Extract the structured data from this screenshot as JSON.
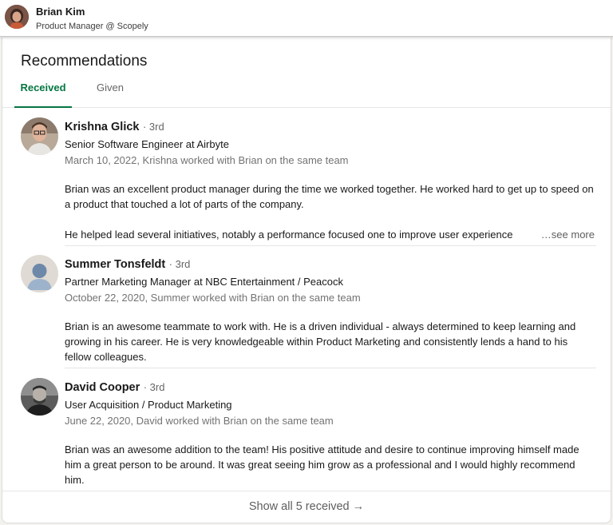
{
  "profile": {
    "name": "Brian Kim",
    "headline": "Product Manager @ Scopely"
  },
  "card": {
    "title": "Recommendations",
    "tabs": [
      {
        "label": "Received",
        "active": true
      },
      {
        "label": "Given",
        "active": false
      }
    ]
  },
  "recommendations": [
    {
      "name": "Krishna Glick",
      "degree": "· 3rd",
      "title": "Senior Software Engineer at Airbyte",
      "meta": "March 10, 2022, Krishna worked with Brian on the same team",
      "paragraphs": [
        "Brian was an excellent product manager during the time we worked together. He worked hard to get up to speed on a product that touched a lot of parts of the company.",
        "He helped lead several initiatives, notably a performance focused one to improve user experience"
      ],
      "see_more": "…see more",
      "avatar_icon": "person-photo"
    },
    {
      "name": "Summer Tonsfeldt",
      "degree": "· 3rd",
      "title": "Partner Marketing Manager at NBC Entertainment / Peacock",
      "meta": "October 22, 2020, Summer worked with Brian on the same team",
      "paragraphs": [
        "Brian is an awesome teammate to work with. He is a driven individual - always determined to keep learning and growing in his career. He is very knowledgeable within Product Marketing and consistently lends a hand to his fellow colleagues."
      ],
      "avatar_icon": "default-person-avatar"
    },
    {
      "name": "David Cooper",
      "degree": "· 3rd",
      "title": "User Acquisition / Product Marketing",
      "meta": "June 22, 2020, David worked with Brian on the same team",
      "paragraphs": [
        "Brian was an awesome addition to the team! His positive attitude and desire to continue improving himself made him a great person to be around. It was great seeing him grow as a professional and I would highly recommend him."
      ],
      "avatar_icon": "person-photo"
    }
  ],
  "footer": {
    "show_all": "Show all 5 received",
    "arrow": "→"
  },
  "colors": {
    "accent_green": "#057642",
    "muted_text": "#737373",
    "text": "#191919"
  }
}
